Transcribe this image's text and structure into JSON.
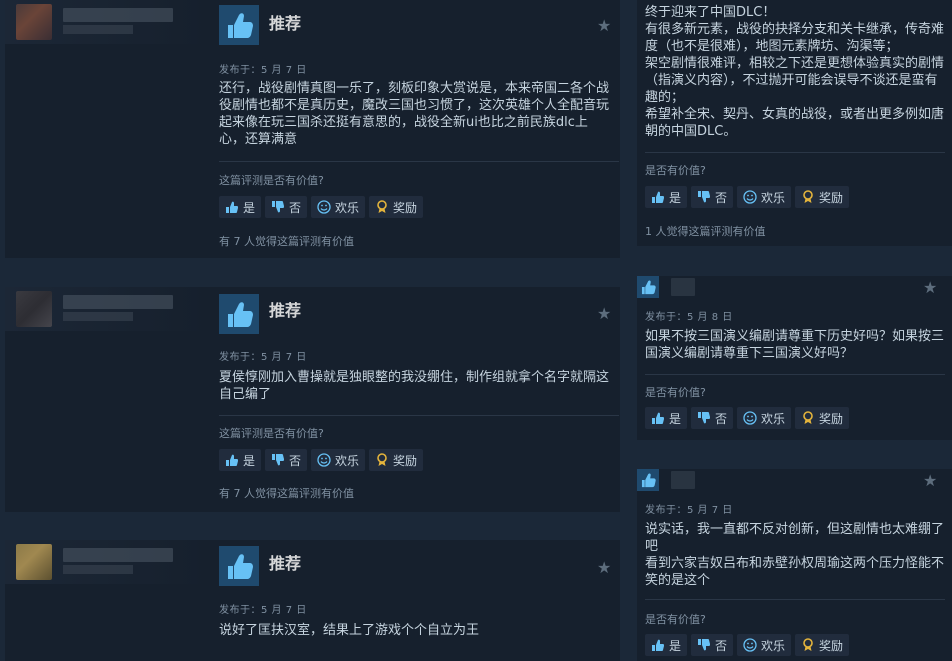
{
  "reviews_left": [
    {
      "recommend_label": "推荐",
      "date": "发布于：5 月 7 日",
      "text": "还行，战役剧情真图一乐了，刻板印象大赏说是，本来帝国二各个战役剧情也都不是真历史，魔改三国也习惯了，这次英雄个人全配音玩起来像在玩三国杀还挺有意思的，战役全新ui也比之前民族dlc上心，还算满意",
      "helpful_question": "这篇评测是否有价值?",
      "buttons": {
        "yes": "是",
        "no": "否",
        "funny": "欢乐",
        "award": "奖励"
      },
      "helpful_count": "有 7 人觉得这篇评测有价值"
    },
    {
      "recommend_label": "推荐",
      "date": "发布于：5 月 7 日",
      "text": "夏侯惇刚加入曹操就是独眼整的我没绷住，制作组就拿个名字就隔这自己编了",
      "helpful_question": "这篇评测是否有价值?",
      "buttons": {
        "yes": "是",
        "no": "否",
        "funny": "欢乐",
        "award": "奖励"
      },
      "helpful_count": "有 7 人觉得这篇评测有价值"
    },
    {
      "recommend_label": "推荐",
      "date": "发布于：5 月 7 日",
      "text": "说好了匡扶汉室，结果上了游戏个个自立为王"
    }
  ],
  "reviews_right": [
    {
      "text_lines": [
        "终于迎来了中国DLC！",
        "有很多新元素，战役的抉择分支和关卡继承，传奇难度（也不是很难），地图元素牌坊、沟渠等；",
        "架空剧情很难评，相较之下还是更想体验真实的剧情（指演义内容），不过抛开可能会误导不谈还是蛮有趣的；",
        "希望补全宋、契丹、女真的战役，或者出更多例如唐朝的中国DLC。"
      ],
      "helpful_question": "是否有价值?",
      "buttons": {
        "yes": "是",
        "no": "否",
        "funny": "欢乐",
        "award": "奖励"
      },
      "helpful_count": "1 人觉得这篇评测有价值"
    },
    {
      "date": "发布于：5 月 8 日",
      "text": "如果不按三国演义编剧请尊重下历史好吗？如果按三国演义编剧请尊重下三国演义好吗？",
      "helpful_question": "是否有价值?",
      "buttons": {
        "yes": "是",
        "no": "否",
        "funny": "欢乐",
        "award": "奖励"
      }
    },
    {
      "date": "发布于：5 月 7 日",
      "text": "说实话，我一直都不反对创新，但这剧情也太难绷了吧\n看到六家吉奴吕布和赤壁孙权周瑜这两个压力怪能不笑的是这个",
      "helpful_question": "是否有价值?",
      "buttons": {
        "yes": "是",
        "no": "否",
        "funny": "欢乐",
        "award": "奖励"
      }
    }
  ],
  "colors": {
    "background": "#1b2838",
    "card": "#16202d",
    "accent_blue": "#66c0f4",
    "award_gold": "#e4b43c"
  }
}
